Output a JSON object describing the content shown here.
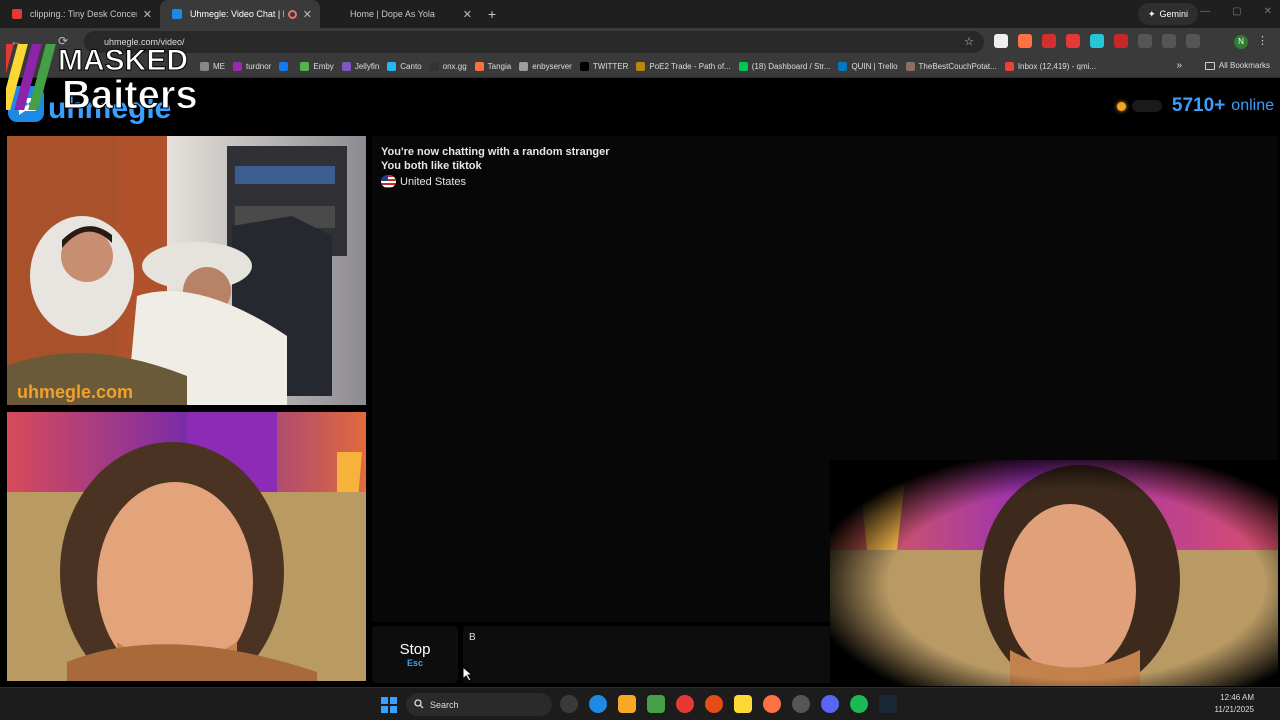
{
  "browser": {
    "tabs": [
      {
        "title": "clipping.: Tiny Desk Concert - Y",
        "color": "#e53935",
        "active": false
      },
      {
        "title": "Uhmegle: Video Chat | Ran",
        "color": "#1e88e5",
        "active": true
      },
      {
        "title": "Home | Dope As Yola",
        "color": "#1f1f1f",
        "active": false
      }
    ],
    "new_tab": "+",
    "gemini_label": "Gemini",
    "url": "uhmegle.com/video/",
    "profile_initial": "N",
    "bookmarks": [
      {
        "label": "ME",
        "color": "#888888"
      },
      {
        "label": "turdnor",
        "color": "#9c27b0"
      },
      {
        "label": "",
        "color": "#1877f2"
      },
      {
        "label": "Emby",
        "color": "#52b54b"
      },
      {
        "label": "Jellyfin",
        "color": "#7e57c2"
      },
      {
        "label": "Canto",
        "color": "#29b6f6"
      },
      {
        "label": "onx.gg",
        "color": "#333333"
      },
      {
        "label": "Tangia",
        "color": "#ff7043"
      },
      {
        "label": "enbyserver",
        "color": "#9e9e9e"
      },
      {
        "label": "TWITTER",
        "color": "#000000"
      },
      {
        "label": "PoE2 Trade - Path of...",
        "color": "#b8860b"
      },
      {
        "label": "(18) Dashboard / Str...",
        "color": "#00c853"
      },
      {
        "label": "QUIN | Trello",
        "color": "#0079bf"
      },
      {
        "label": "TheBestCouchPotat...",
        "color": "#8d6e63"
      },
      {
        "label": "Inbox (12,419) - qmi...",
        "color": "#ea4335"
      }
    ],
    "all_bookmarks": "All Bookmarks",
    "more_bookmarks": "»"
  },
  "overlay": {
    "brand_line1": "MASKED",
    "brand_line2": "Baiters"
  },
  "site": {
    "logo_text": "uhmegle",
    "online_count": "5710+",
    "online_label": "online",
    "accent": "#3aa0ff",
    "stranger_watermark": "uhmegle.com",
    "chat": {
      "line1": "You're now chatting with a random stranger",
      "line2": "You both like tiktok",
      "country": "United States"
    },
    "stop_label": "Stop",
    "stop_shortcut": "Esc",
    "message_input_value": "B"
  },
  "taskbar": {
    "search_placeholder": "Search",
    "time": "12:46 AM",
    "date": "11/21/2025"
  }
}
